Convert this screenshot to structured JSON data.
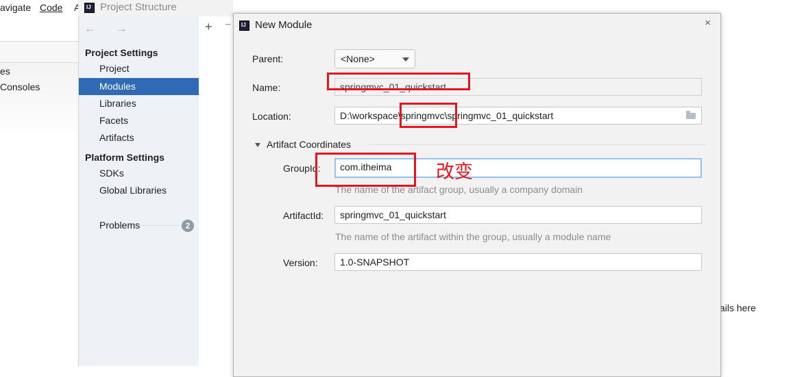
{
  "ide": {
    "menu": [
      "avigate",
      "Code",
      "A"
    ],
    "left_panel_items": [
      "es",
      "Consoles"
    ]
  },
  "project_structure": {
    "title": "Project Structure",
    "nav_arrows": "← →",
    "sidebar": {
      "project_settings_header": "Project Settings",
      "project_settings_items": [
        "Project",
        "Modules",
        "Libraries",
        "Facets",
        "Artifacts"
      ],
      "platform_settings_header": "Platform Settings",
      "platform_settings_items": [
        "SDKs",
        "Global Libraries"
      ],
      "problems_label": "Problems",
      "problems_count": "2",
      "selected": "Modules"
    },
    "toolbar": {
      "add": "+",
      "remove": "−"
    },
    "content_hint": "ails here"
  },
  "dialog": {
    "title": "New Module",
    "close": "×",
    "parent_label": "Parent:",
    "parent_value": "<None>",
    "name_label": "Name:",
    "name_value": "springmvc_01_quickstart",
    "location_label": "Location:",
    "location_value": "D:\\workspace\\springmvc\\springmvc_01_quickstart",
    "artifact_section": "Artifact Coordinates",
    "groupid_label": "GroupId:",
    "groupid_value": "com.itheima",
    "groupid_hint": "The name of the artifact group, usually a company domain",
    "artifactid_label": "ArtifactId:",
    "artifactid_value": "springmvc_01_quickstart",
    "artifactid_hint": "The name of the artifact within the group, usually a module name",
    "version_label": "Version:",
    "version_value": "1.0-SNAPSHOT"
  },
  "annotations": {
    "change_text": "改变",
    "color": "#e8141c"
  },
  "colors": {
    "selection": "#2e6bb4",
    "focus_border": "#97c3ea",
    "sidebar_bg": "#eef2f6"
  }
}
